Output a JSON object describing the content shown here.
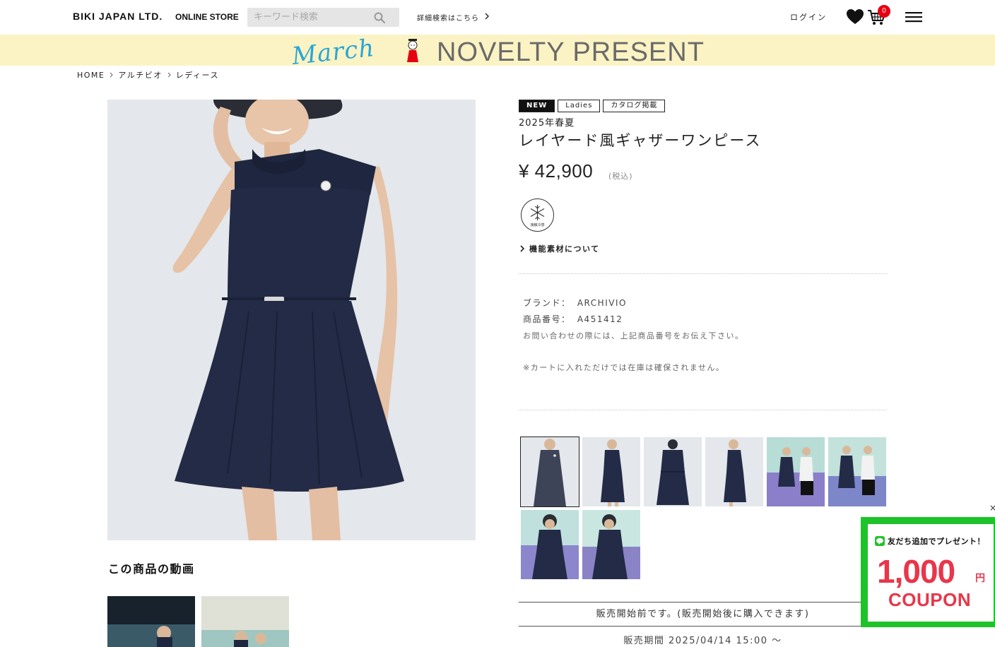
{
  "header": {
    "logo": "BIKI JAPAN LTD.",
    "logo_sub": "ONLINE STORE",
    "search_placeholder": "キーワード検索",
    "advanced_search": "詳細検索はこちら",
    "login": "ログイン",
    "cart_count": "0"
  },
  "banner": {
    "script": "March",
    "title": "NOVELTY PRESENT"
  },
  "breadcrumb": [
    "HOME",
    "アルチビオ",
    "レディース"
  ],
  "product": {
    "badges": [
      "NEW",
      "Ladies",
      "カタログ掲載"
    ],
    "season": "2025年春夏",
    "title": "レイヤード風ギャザーワンピース",
    "price": "¥ 42,900",
    "tax": "(税込)",
    "feature_label": "接触冷感",
    "feature_link": "機能素材について",
    "brand_label": "ブランド：",
    "brand": "ARCHIVIO",
    "sku_label": "商品番号：",
    "sku": "A451412",
    "inquiry_note": "お問い合わせの際には、上記商品番号をお伝え下さい。",
    "stock_note": "※カートに入れただけでは在庫は確保されません。",
    "sale_status": "販売開始前です。(販売開始後に購入できます)",
    "sale_period": "販売期間 2025/04/14 15:00 〜"
  },
  "video": {
    "heading": "この商品の動画"
  },
  "coupon": {
    "top": "友だち追加でプレゼント！",
    "amount": "1,000",
    "yen": "円",
    "word": "COUPON"
  },
  "colors": {
    "banner_bg": "#fbf3c3",
    "accent_red": "#e60012",
    "line_green": "#1ec32b",
    "coupon_red": "#e8364a",
    "navy": "#1c2336"
  }
}
